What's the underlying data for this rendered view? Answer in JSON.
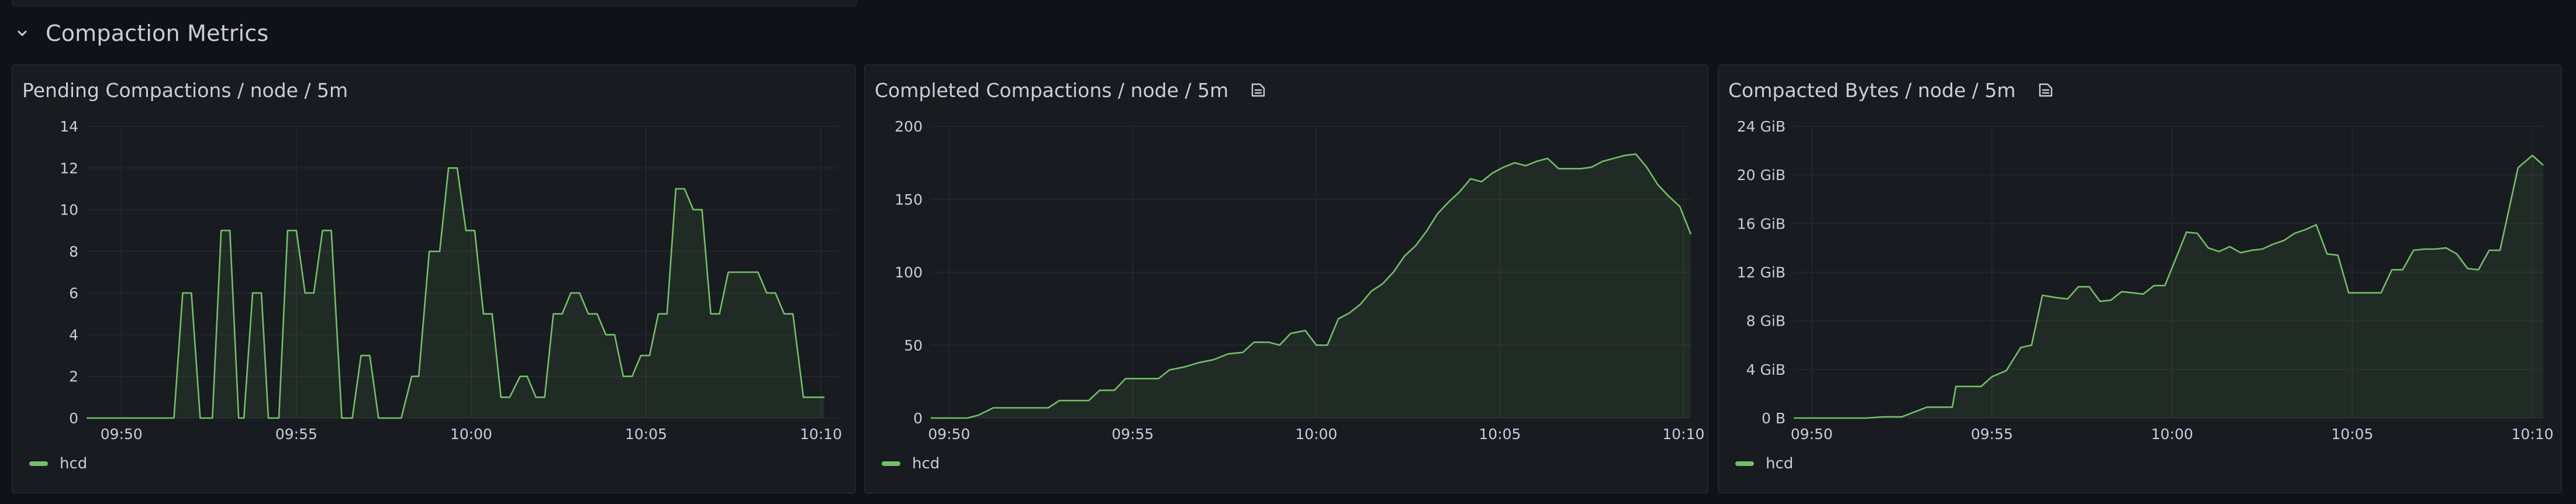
{
  "row": {
    "title": "Compaction Metrics"
  },
  "panels": [
    {
      "title": "Pending Compactions / node / 5m",
      "has_info_icon": false,
      "legend": "hcd"
    },
    {
      "title": "Completed Compactions / node / 5m",
      "has_info_icon": true,
      "legend": "hcd"
    },
    {
      "title": "Compacted Bytes / node / 5m",
      "has_info_icon": true,
      "legend": "hcd"
    }
  ],
  "colors": {
    "series": "#73bf69",
    "grid": "#24262b",
    "text": "#ccccdc"
  },
  "icons": {
    "row_toggle": "chevron-down-icon",
    "panel_info": "info-icon"
  },
  "chart_data": [
    {
      "type": "area",
      "title": "Pending Compactions / node / 5m",
      "xlim": [
        "09:49",
        "10:10.5"
      ],
      "x_ticks": [
        "09:50",
        "09:55",
        "10:00",
        "10:05",
        "10:10"
      ],
      "ylim": [
        0,
        14
      ],
      "y_ticks": [
        "0",
        "2",
        "4",
        "6",
        "8",
        "10",
        "12",
        "14"
      ],
      "grid": true,
      "legend_position": "bottom-left",
      "series": [
        {
          "name": "hcd",
          "points": [
            [
              "09:49.0",
              0
            ],
            [
              "09:51.5",
              0
            ],
            [
              "09:51.75",
              6
            ],
            [
              "09:52.0",
              6
            ],
            [
              "09:52.25",
              0
            ],
            [
              "09:52.6",
              0
            ],
            [
              "09:52.85",
              9
            ],
            [
              "09:53.1",
              9
            ],
            [
              "09:53.35",
              0
            ],
            [
              "09:53.5",
              0
            ],
            [
              "09:53.75",
              6
            ],
            [
              "09:54.0",
              6
            ],
            [
              "09:54.2",
              0
            ],
            [
              "09:54.5",
              0
            ],
            [
              "09:54.75",
              9
            ],
            [
              "09:55.0",
              9
            ],
            [
              "09:55.25",
              6
            ],
            [
              "09:55.5",
              6
            ],
            [
              "09:55.75",
              9
            ],
            [
              "09:56.0",
              9
            ],
            [
              "09:56.3",
              0
            ],
            [
              "09:56.6",
              0
            ],
            [
              "09:56.85",
              3
            ],
            [
              "09:57.1",
              3
            ],
            [
              "09:57.35",
              0
            ],
            [
              "09:58.0",
              0
            ],
            [
              "09:58.3",
              2
            ],
            [
              "09:58.5",
              2
            ],
            [
              "09:58.8",
              8
            ],
            [
              "09:59.1",
              8
            ],
            [
              "09:59.35",
              12
            ],
            [
              "09:59.6",
              12
            ],
            [
              "09:59.85",
              9
            ],
            [
              "10:00.1",
              9
            ],
            [
              "10:00.35",
              5
            ],
            [
              "10:00.6",
              5
            ],
            [
              "10:00.85",
              1
            ],
            [
              "10:01.1",
              1
            ],
            [
              "10:01.4",
              2
            ],
            [
              "10:01.6",
              2
            ],
            [
              "10:01.85",
              1
            ],
            [
              "10:02.1",
              1
            ],
            [
              "10:02.35",
              5
            ],
            [
              "10:02.6",
              5
            ],
            [
              "10:02.85",
              6
            ],
            [
              "10:03.1",
              6
            ],
            [
              "10:03.35",
              5
            ],
            [
              "10:03.6",
              5
            ],
            [
              "10:03.85",
              4
            ],
            [
              "10:04.1",
              4
            ],
            [
              "10:04.35",
              2
            ],
            [
              "10:04.6",
              2
            ],
            [
              "10:04.85",
              3
            ],
            [
              "10:05.1",
              3
            ],
            [
              "10:05.35",
              5
            ],
            [
              "10:05.6",
              5
            ],
            [
              "10:05.85",
              11
            ],
            [
              "10:06.1",
              11
            ],
            [
              "10:06.35",
              10
            ],
            [
              "10:06.6",
              10
            ],
            [
              "10:06.85",
              5
            ],
            [
              "10:07.1",
              5
            ],
            [
              "10:07.35",
              7
            ],
            [
              "10:08.2",
              7
            ],
            [
              "10:08.45",
              6
            ],
            [
              "10:08.7",
              6
            ],
            [
              "10:08.95",
              5
            ],
            [
              "10:09.2",
              5
            ],
            [
              "10:09.5",
              1
            ],
            [
              "10:10.1",
              1
            ]
          ]
        }
      ]
    },
    {
      "type": "area",
      "title": "Completed Compactions / node / 5m",
      "xlim": [
        "09:49.5",
        "10:10.2"
      ],
      "x_ticks": [
        "09:50",
        "09:55",
        "10:00",
        "10:05",
        "10:10"
      ],
      "ylim": [
        0,
        200
      ],
      "y_ticks": [
        "0",
        "50",
        "100",
        "150",
        "200"
      ],
      "grid": true,
      "legend_position": "bottom-left",
      "series": [
        {
          "name": "hcd",
          "points": [
            [
              "09:49.5",
              0
            ],
            [
              "09:50.5",
              0
            ],
            [
              "09:50.8",
              2
            ],
            [
              "09:51.2",
              7
            ],
            [
              "09:52.0",
              7
            ],
            [
              "09:52.7",
              7
            ],
            [
              "09:53.0",
              12
            ],
            [
              "09:53.8",
              12
            ],
            [
              "09:54.1",
              19
            ],
            [
              "09:54.5",
              19
            ],
            [
              "09:54.8",
              27
            ],
            [
              "09:55.7",
              27
            ],
            [
              "09:56.0",
              33
            ],
            [
              "09:56.4",
              35
            ],
            [
              "09:56.8",
              38
            ],
            [
              "09:57.2",
              40
            ],
            [
              "09:57.6",
              44
            ],
            [
              "09:58.0",
              45
            ],
            [
              "09:58.3",
              52
            ],
            [
              "09:58.7",
              52
            ],
            [
              "09:59.0",
              50
            ],
            [
              "09:59.3",
              58
            ],
            [
              "09:59.7",
              60
            ],
            [
              "10:00.0",
              50
            ],
            [
              "10:00.3",
              50
            ],
            [
              "10:00.6",
              68
            ],
            [
              "10:00.9",
              72
            ],
            [
              "10:01.2",
              78
            ],
            [
              "10:01.5",
              87
            ],
            [
              "10:01.8",
              92
            ],
            [
              "10:02.1",
              100
            ],
            [
              "10:02.4",
              111
            ],
            [
              "10:02.7",
              118
            ],
            [
              "10:03.0",
              128
            ],
            [
              "10:03.3",
              140
            ],
            [
              "10:03.6",
              148
            ],
            [
              "10:03.9",
              155
            ],
            [
              "10:04.2",
              164
            ],
            [
              "10:04.5",
              162
            ],
            [
              "10:04.8",
              168
            ],
            [
              "10:05.1",
              172
            ],
            [
              "10:05.4",
              175
            ],
            [
              "10:05.7",
              173
            ],
            [
              "10:06.0",
              176
            ],
            [
              "10:06.3",
              178
            ],
            [
              "10:06.6",
              171
            ],
            [
              "10:06.9",
              171
            ],
            [
              "10:07.2",
              171
            ],
            [
              "10:07.5",
              172
            ],
            [
              "10:07.8",
              176
            ],
            [
              "10:08.1",
              178
            ],
            [
              "10:08.4",
              180
            ],
            [
              "10:08.7",
              181
            ],
            [
              "10:09.0",
              172
            ],
            [
              "10:09.3",
              160
            ],
            [
              "10:09.6",
              152
            ],
            [
              "10:09.9",
              145
            ],
            [
              "10:10.2",
              126
            ]
          ]
        }
      ]
    },
    {
      "type": "area",
      "title": "Compacted Bytes / node / 5m",
      "xlim": [
        "09:49.5",
        "10:10.3"
      ],
      "x_ticks": [
        "09:50",
        "09:55",
        "10:00",
        "10:05",
        "10:10"
      ],
      "ylim": [
        0,
        24
      ],
      "y_ticks": [
        "0 B",
        "4 GiB",
        "8 GiB",
        "12 GiB",
        "16 GiB",
        "20 GiB",
        "24 GiB"
      ],
      "y_unit": "GiB",
      "grid": true,
      "legend_position": "bottom-left",
      "series": [
        {
          "name": "hcd",
          "points": [
            [
              "09:49.5",
              0
            ],
            [
              "09:51.5",
              0
            ],
            [
              "09:52.0",
              0.1
            ],
            [
              "09:52.5",
              0.1
            ],
            [
              "09:53.2",
              0.9
            ],
            [
              "09:53.9",
              0.9
            ],
            [
              "09:54.0",
              2.6
            ],
            [
              "09:54.7",
              2.6
            ],
            [
              "09:55.0",
              3.4
            ],
            [
              "09:55.4",
              3.9
            ],
            [
              "09:55.8",
              5.8
            ],
            [
              "09:56.1",
              6.0
            ],
            [
              "09:56.4",
              10.1
            ],
            [
              "09:56.8",
              9.9
            ],
            [
              "09:57.1",
              9.8
            ],
            [
              "09:57.4",
              10.8
            ],
            [
              "09:57.7",
              10.8
            ],
            [
              "09:58.0",
              9.6
            ],
            [
              "09:58.3",
              9.7
            ],
            [
              "09:58.6",
              10.4
            ],
            [
              "09:58.9",
              10.3
            ],
            [
              "09:59.2",
              10.2
            ],
            [
              "09:59.5",
              10.9
            ],
            [
              "09:59.8",
              10.9
            ],
            [
              "10:00.1",
              13.1
            ],
            [
              "10:00.4",
              15.3
            ],
            [
              "10:00.7",
              15.2
            ],
            [
              "10:01.0",
              14.0
            ],
            [
              "10:01.3",
              13.7
            ],
            [
              "10:01.6",
              14.1
            ],
            [
              "10:01.9",
              13.6
            ],
            [
              "10:02.2",
              13.8
            ],
            [
              "10:02.5",
              13.9
            ],
            [
              "10:02.8",
              14.3
            ],
            [
              "10:03.1",
              14.6
            ],
            [
              "10:03.4",
              15.2
            ],
            [
              "10:03.7",
              15.5
            ],
            [
              "10:04.0",
              15.9
            ],
            [
              "10:04.3",
              13.5
            ],
            [
              "10:04.6",
              13.4
            ],
            [
              "10:04.9",
              10.3
            ],
            [
              "10:05.2",
              10.3
            ],
            [
              "10:05.5",
              10.3
            ],
            [
              "10:05.8",
              10.3
            ],
            [
              "10:06.1",
              12.2
            ],
            [
              "10:06.4",
              12.2
            ],
            [
              "10:06.7",
              13.8
            ],
            [
              "10:07.0",
              13.9
            ],
            [
              "10:07.3",
              13.9
            ],
            [
              "10:07.6",
              14.0
            ],
            [
              "10:07.9",
              13.5
            ],
            [
              "10:08.2",
              12.3
            ],
            [
              "10:08.5",
              12.2
            ],
            [
              "10:08.8",
              13.8
            ],
            [
              "10:09.1",
              13.8
            ],
            [
              "10:09.6",
              20.6
            ],
            [
              "10:10.0",
              21.6
            ],
            [
              "10:10.3",
              20.8
            ]
          ]
        }
      ]
    }
  ]
}
